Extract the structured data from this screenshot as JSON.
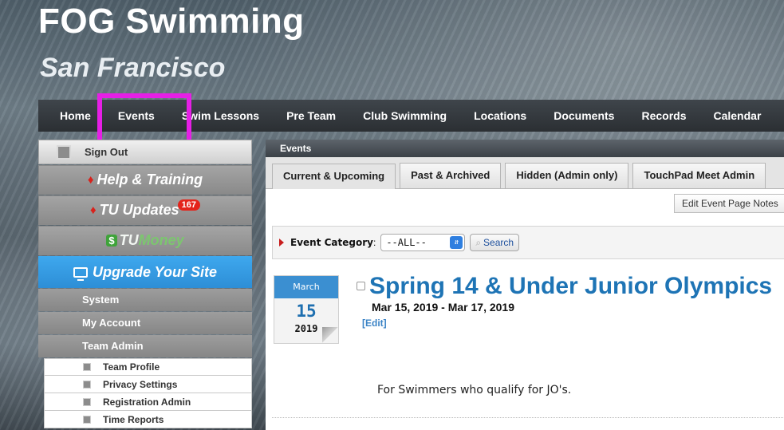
{
  "header": {
    "title": "FOG Swimming",
    "subtitle": "San Francisco"
  },
  "nav": {
    "items": [
      {
        "label": "Home"
      },
      {
        "label": "Events"
      },
      {
        "label": "Swim Lessons"
      },
      {
        "label": "Pre Team"
      },
      {
        "label": "Club Swimming"
      },
      {
        "label": "Locations"
      },
      {
        "label": "Documents"
      },
      {
        "label": "Records"
      },
      {
        "label": "Calendar"
      }
    ],
    "highlight_color": "#e61fe6"
  },
  "sidebar": {
    "sign_out": "Sign Out",
    "help": "Help & Training",
    "updates": "TU Updates",
    "updates_badge": "167",
    "tumoney_tu": "TU",
    "tumoney_money": "Money",
    "upgrade": "Upgrade Your Site",
    "sections": [
      "System",
      "My Account",
      "Team Admin"
    ],
    "team_admin_items": [
      "Team Profile",
      "Privacy Settings",
      "Registration Admin",
      "Time Reports"
    ]
  },
  "content": {
    "header": "Events",
    "tabs": [
      {
        "label": "Current & Upcoming",
        "active": true
      },
      {
        "label": "Past & Archived",
        "active": false
      },
      {
        "label": "Hidden (Admin only)",
        "active": false
      },
      {
        "label": "TouchPad Meet Admin",
        "active": false
      }
    ],
    "notes_button": "Edit Event Page Notes",
    "filter": {
      "label": "Event Category",
      "selected": "--ALL--",
      "search_label": "Search"
    },
    "event": {
      "month": "March",
      "day": "15",
      "year": "2019",
      "title": "Spring 14 & Under Junior Olympics",
      "dates": "Mar 15, 2019 - Mar 17, 2019",
      "edit": "[Edit]",
      "description": "For Swimmers who qualify for JO's."
    }
  },
  "colors": {
    "accent_blue": "#3b8fd1",
    "title_blue": "#1e74b5",
    "upgrade_blue": "#3ea8ee"
  }
}
